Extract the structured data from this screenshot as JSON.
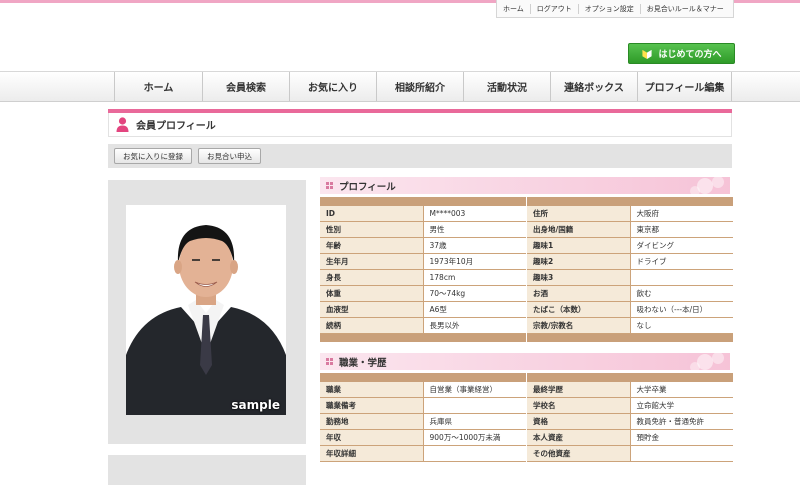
{
  "header": {
    "top_links": [
      "ホーム",
      "ログアウト",
      "オプション設定",
      "お見合いルール＆マナー"
    ],
    "begin_button": "はじめての方へ"
  },
  "nav": [
    "ホーム",
    "会員検索",
    "お気に入り",
    "相談所紹介",
    "活動状況",
    "連絡ボックス",
    "プロフィール編集"
  ],
  "page": {
    "title": "会員プロフィール",
    "actions": [
      "お気に入りに登録",
      "お見合い申込"
    ]
  },
  "photo": {
    "stamp": "sample"
  },
  "profile": {
    "heading": "プロフィール",
    "left": [
      {
        "k": "ID",
        "v": "M****003"
      },
      {
        "k": "性別",
        "v": "男性"
      },
      {
        "k": "年齢",
        "v": "37歳"
      },
      {
        "k": "生年月",
        "v": "1973年10月"
      },
      {
        "k": "身長",
        "v": "178cm"
      },
      {
        "k": "体重",
        "v": "70～74kg"
      },
      {
        "k": "血液型",
        "v": "A6型"
      },
      {
        "k": "続柄",
        "v": "長男以外"
      }
    ],
    "right": [
      {
        "k": "住所",
        "v": "大阪府"
      },
      {
        "k": "出身地/国籍",
        "v": "東京都"
      },
      {
        "k": "趣味1",
        "v": "ダイビング"
      },
      {
        "k": "趣味2",
        "v": "ドライブ"
      },
      {
        "k": "趣味3",
        "v": ""
      },
      {
        "k": "お酒",
        "v": "飲む"
      },
      {
        "k": "たばこ（本数）",
        "v": "吸わない（---本/日）"
      },
      {
        "k": "宗教/宗教名",
        "v": "なし"
      }
    ]
  },
  "career": {
    "heading": "職業・学歴",
    "left": [
      {
        "k": "職業",
        "v": "自営業（事業経営）"
      },
      {
        "k": "職業備考",
        "v": ""
      },
      {
        "k": "勤務地",
        "v": "兵庫県"
      },
      {
        "k": "年収",
        "v": "900万～1000万未満"
      },
      {
        "k": "年収詳細",
        "v": ""
      }
    ],
    "right": [
      {
        "k": "最終学歴",
        "v": "大学卒業"
      },
      {
        "k": "学校名",
        "v": "立命館大学"
      },
      {
        "k": "資格",
        "v": "教員免許・普通免許"
      },
      {
        "k": "本人資産",
        "v": "預貯金"
      },
      {
        "k": "その他資産",
        "v": ""
      }
    ]
  },
  "colors": {
    "accent_pink": "#e9699a",
    "table_brown": "#c9a07a",
    "key_cell": "#f5ead9",
    "green_button": "#3aa832"
  }
}
